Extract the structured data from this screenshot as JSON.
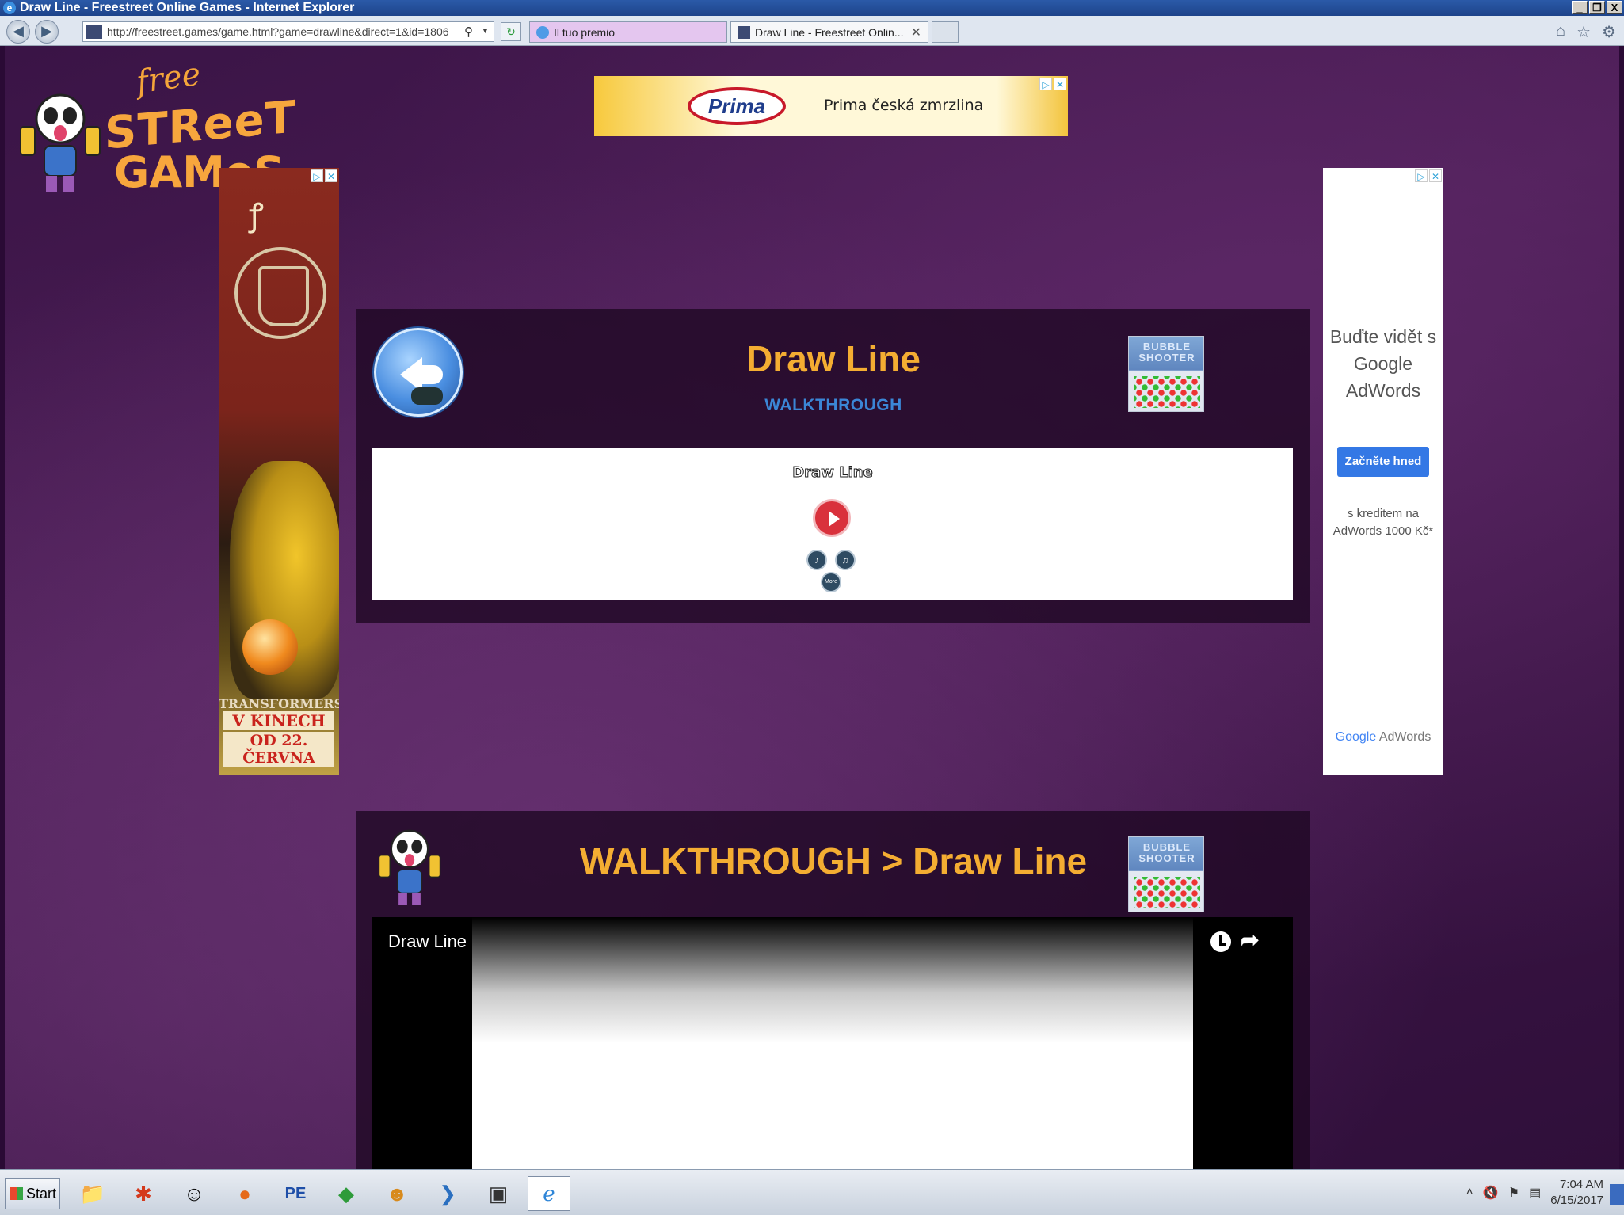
{
  "window": {
    "title": "Draw Line - Freestreet Online Games - Internet Explorer",
    "min": "_",
    "restore": "❐",
    "close": "X"
  },
  "browser": {
    "back_icon": "back-arrow-icon",
    "forward_icon": "forward-arrow-icon",
    "url": "http://freestreet.games/game.html?game=drawline&direct=1&id=1806",
    "tabs": [
      {
        "label": "Il tuo premio"
      },
      {
        "label": "Draw Line - Freestreet Onlin..."
      }
    ],
    "tab_close": "✕",
    "home_icon": "⌂",
    "star_icon": "☆",
    "gear_icon": "⚙"
  },
  "site": {
    "logo_free": "free",
    "logo_street": "STReeT",
    "logo_games": "GAMeS"
  },
  "ads": {
    "top": {
      "brand": "Prima",
      "slogan": "Prima česká zmrzlina",
      "adchoice": "▷",
      "close": "✕"
    },
    "left": {
      "symbol": "ꝭ",
      "line1": "TRANSFORMERS",
      "line2": "V KINECH",
      "line3": "OD 22. ČERVNA"
    },
    "right": {
      "headline": "Buďte vidět s Google AdWords",
      "cta": "Začněte hned",
      "credit": "s kreditem na AdWords 1000 Kč*",
      "google": "Google",
      "adwords": " AdWords"
    }
  },
  "game_panel": {
    "title": "Draw Line",
    "subtitle": "WALKTHROUGH",
    "thumb_title": "BUBBLE SHOOTER",
    "game_title": "Draw Line",
    "mini_btn_1": "♪",
    "mini_btn_2": "♫",
    "mini_btn_3": "More"
  },
  "walkthrough_panel": {
    "title": "WALKTHROUGH > Draw Line",
    "video_title": "Draw Line",
    "share": "➦"
  },
  "taskbar": {
    "start": "Start",
    "time": "7:04 AM",
    "date": "6/15/2017"
  }
}
